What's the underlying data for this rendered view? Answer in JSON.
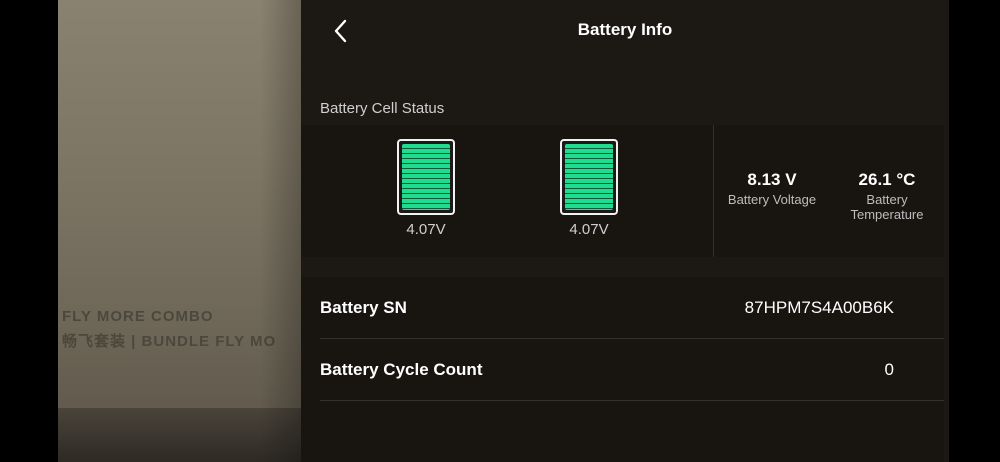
{
  "camera_feed": {
    "box_text_line1": "FLY MORE COMBO",
    "box_text_line2": "畅飞套装 | BUNDLE FLY MO"
  },
  "header": {
    "title": "Battery Info",
    "back_icon": "chevron-left-icon"
  },
  "cell_status": {
    "section_label": "Battery Cell Status",
    "cells": [
      {
        "voltage": "4.07V",
        "level": 1.0
      },
      {
        "voltage": "4.07V",
        "level": 1.0
      }
    ],
    "cell_color": "#1fdc8e",
    "voltage": {
      "value": "8.13 V",
      "label": "Battery Voltage"
    },
    "temperature": {
      "value": "26.1 °C",
      "label_line1": "Battery",
      "label_line2": "Temperature"
    }
  },
  "details": [
    {
      "label": "Battery SN",
      "value": "87HPM7S4A00B6K"
    },
    {
      "label": "Battery Cycle Count",
      "value": "0"
    }
  ]
}
